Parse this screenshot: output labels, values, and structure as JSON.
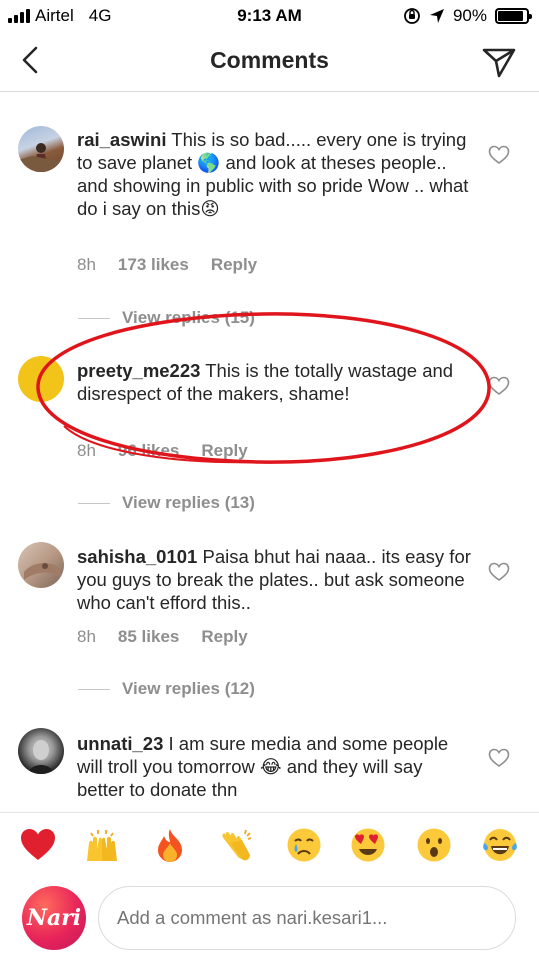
{
  "status_bar": {
    "carrier": "Airtel",
    "network": "4G",
    "time": "9:13 AM",
    "battery": "90%",
    "battery_level": 0.9
  },
  "header": {
    "title": "Comments"
  },
  "comments": [
    {
      "username": "rai_aswini",
      "text": "This is so bad..... every one is trying to save planet 🌎 and look at theses people.. and showing in public with so pride Wow .. what do i say on this😡",
      "time": "8h",
      "likes": "173 likes",
      "reply_label": "Reply",
      "view_replies": "View replies (15)"
    },
    {
      "username": "preety_me223",
      "text": "This is the totally wastage and disrespect of the makers, shame!",
      "time": "8h",
      "likes": "96 likes",
      "reply_label": "Reply",
      "view_replies": "View replies (13)"
    },
    {
      "username": "sahisha_0101",
      "text": "Paisa bhut hai naaa.. its easy for you guys to break the plates.. but ask someone who can't efford this..",
      "time": "8h",
      "likes": "85 likes",
      "reply_label": "Reply",
      "view_replies": "View replies (12)"
    },
    {
      "username": "unnati_23",
      "text": "I am sure media and some people will troll you tomorrow 😂 and they will say better to donate thn",
      "time": "",
      "likes": "",
      "reply_label": "",
      "view_replies": ""
    }
  ],
  "emoji_bar": [
    "❤️",
    "🙌",
    "🔥",
    "👏",
    "😢",
    "😍",
    "😮",
    "😂"
  ],
  "composer": {
    "avatar_label": "Nari",
    "placeholder": "Add a comment as nari.kesari1..."
  },
  "colors": {
    "annotation": "#e0151c",
    "muted": "#8e8e8e",
    "text": "#262626"
  }
}
